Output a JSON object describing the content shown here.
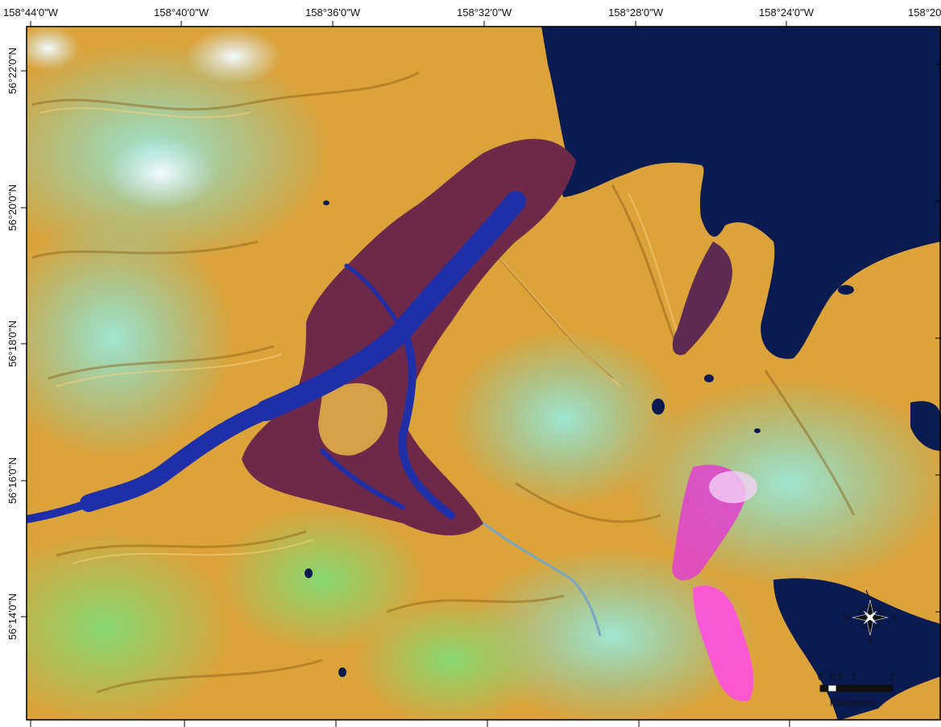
{
  "map": {
    "top_longitude_labels": [
      "158°44'0\"W",
      "158°40'0\"W",
      "158°36'0\"W",
      "158°32'0\"W",
      "158°28'0\"W",
      "158°24'0\"W",
      "158°20"
    ],
    "left_latitude_labels": [
      "56°22'0\"N",
      "56°20'0\"N",
      "56°18'0\"N",
      "56°16'0\"N",
      "56°14'0\"N"
    ],
    "scale_bar": {
      "tick_labels": [
        "0",
        "0.5",
        "1",
        "2"
      ],
      "units": "Kilometers"
    },
    "north_arrow": {
      "west_label": "W",
      "east_label": "E",
      "south_label": "S"
    },
    "colors": {
      "land_gold": "#e3a93a",
      "vegetation_cyan": "#6fd7c4",
      "vegetation_green": "#7fcf74",
      "snow": "#e8f6fb",
      "water_deep": "#0a1b52",
      "river_blue": "#1f2fa8",
      "tidal_flat_maroon": "#6e2848",
      "magenta": "#e040d0"
    }
  }
}
